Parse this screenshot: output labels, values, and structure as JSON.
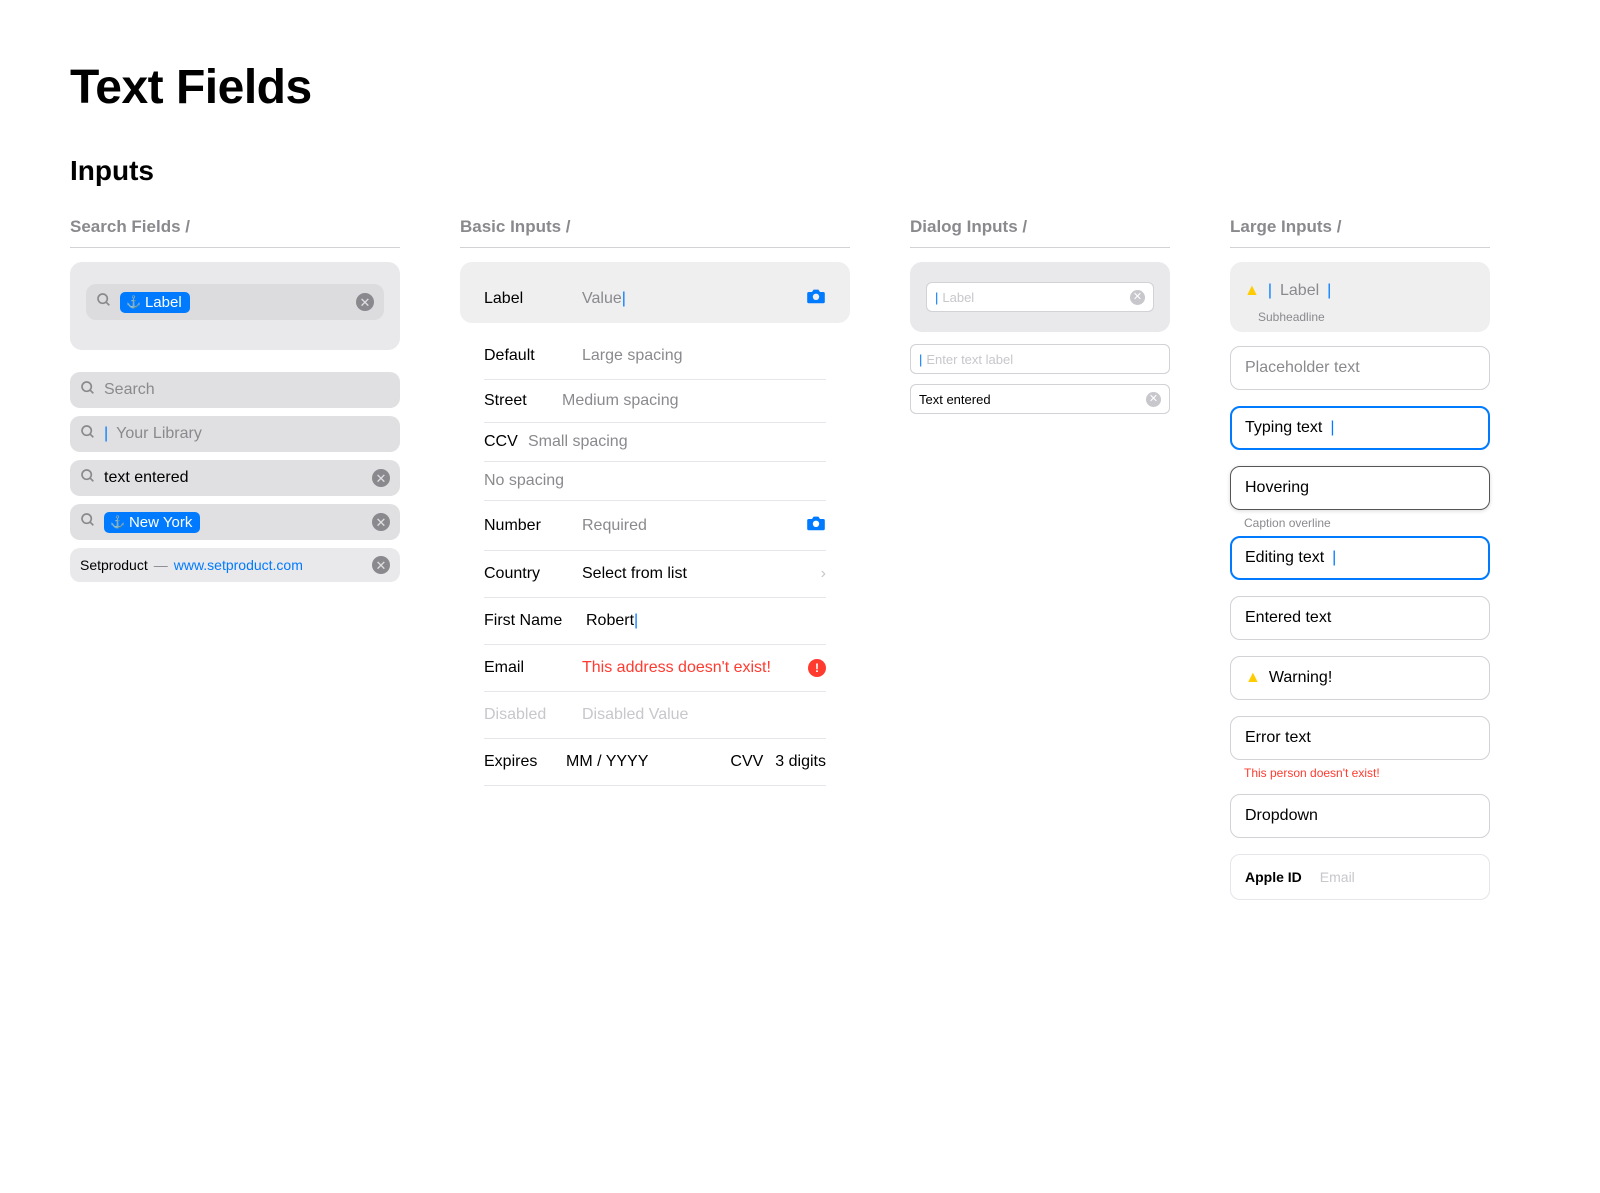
{
  "page": {
    "title": "Text Fields",
    "subtitle": "Inputs"
  },
  "sections": {
    "search": "Search Fields /",
    "basic": "Basic Inputs /",
    "dialog": "Dialog Inputs /",
    "large": "Large Inputs /"
  },
  "search": {
    "tagged1": "Label",
    "placeholder1": "Search",
    "focused_placeholder": "Your Library",
    "entered": "text entered",
    "tagged2": "New York",
    "site_name": "Setproduct",
    "site_dash": "—",
    "site_url": "www.setproduct.com"
  },
  "basic": {
    "r0": {
      "label": "Label",
      "value": "Value"
    },
    "r1": {
      "label": "Default",
      "ph": "Large spacing"
    },
    "r2": {
      "label": "Street",
      "ph": "Medium spacing"
    },
    "r3": {
      "label": "CCV",
      "ph": "Small spacing"
    },
    "r4": {
      "ph": "No spacing"
    },
    "r5": {
      "label": "Number",
      "ph": "Required"
    },
    "r6": {
      "label": "Country",
      "value": "Select from list"
    },
    "r7": {
      "label": "First Name",
      "value": "Robert"
    },
    "r8": {
      "label": "Email",
      "err": "This address doesn't exist!"
    },
    "r9": {
      "label": "Disabled",
      "value": "Disabled Value"
    },
    "r10a": {
      "label": "Expires",
      "ph": "MM / YYYY"
    },
    "r10b": {
      "label": "CVV",
      "ph": "3 digits"
    }
  },
  "dialog": {
    "d1": "Label",
    "d2": "Enter text label",
    "d3": "Text entered"
  },
  "large": {
    "card_label": "Label",
    "card_sub": "Subheadline",
    "l1": "Placeholder text",
    "l2": "Typing text",
    "l3": "Hovering",
    "l4_cap": "Caption overline",
    "l4": "Editing text",
    "l5": "Entered text",
    "l6": "Warning!",
    "l7": "Error text",
    "l7_err": "This person doesn't exist!",
    "l8": "Dropdown",
    "apple_lbl": "Apple ID",
    "apple_val": "Email"
  }
}
